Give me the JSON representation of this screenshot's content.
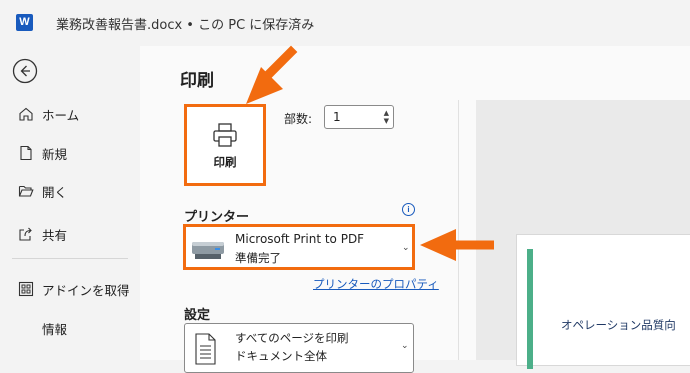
{
  "titlebar": {
    "app_icon_letter": "W",
    "document_title": "業務改善報告書.docx • この PC に保存済み"
  },
  "sidebar": {
    "items": [
      {
        "label": "ホーム",
        "icon": "home-icon"
      },
      {
        "label": "新規",
        "icon": "new-document-icon"
      },
      {
        "label": "開く",
        "icon": "open-folder-icon"
      },
      {
        "label": "共有",
        "icon": "share-icon"
      },
      {
        "label": "アドインを取得",
        "icon": "addins-grid-icon"
      },
      {
        "label": "情報",
        "icon": ""
      }
    ]
  },
  "print": {
    "title": "印刷",
    "print_button_label": "印刷",
    "copies_label": "部数:",
    "copies_value": "1",
    "printer_heading": "プリンター",
    "printer_name": "Microsoft Print to PDF",
    "printer_status": "準備完了",
    "printer_properties_link": "プリンターのプロパティ",
    "settings_heading": "設定",
    "setting_pages_line1": "すべてのページを印刷",
    "setting_pages_line2": "ドキュメント全体"
  },
  "preview": {
    "text": "オペレーション品質向"
  },
  "colors": {
    "highlight": "#f26b0f",
    "accent_blue": "#185abd",
    "preview_bar": "#4caf89"
  }
}
